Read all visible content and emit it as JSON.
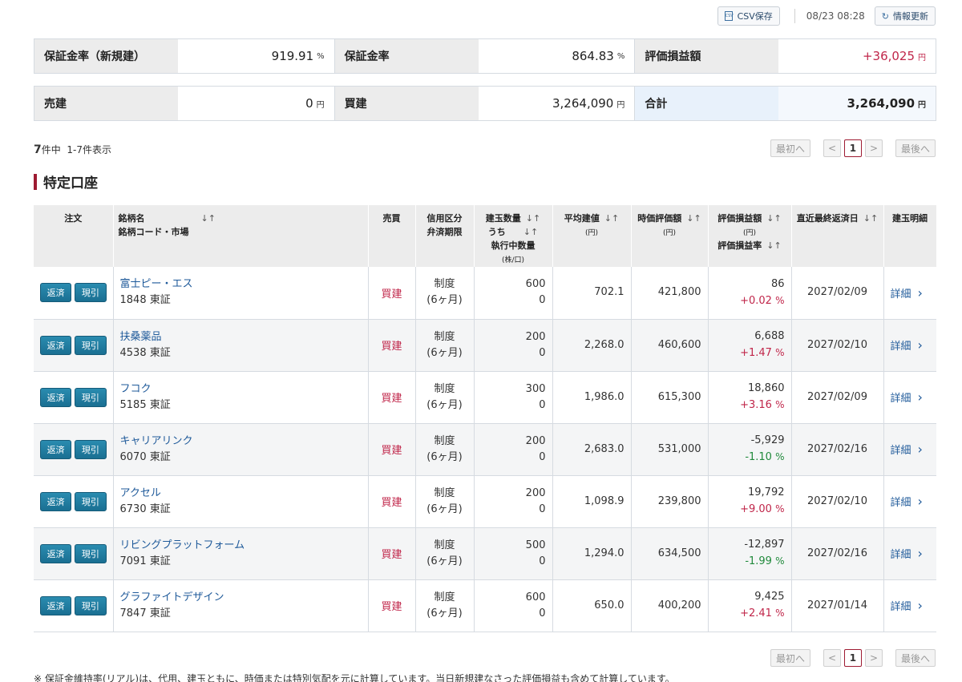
{
  "toolbar": {
    "csv_label": "CSV保存",
    "csv_icon_text": "CSV",
    "timestamp": "08/23 08:28",
    "refresh_label": "情報更新"
  },
  "summary": {
    "row1": [
      {
        "label": "保証金率（新規建）",
        "value": "919.91",
        "unit": "%"
      },
      {
        "label": "保証金率",
        "value": "864.83",
        "unit": "%"
      },
      {
        "label": "評価損益額",
        "value": "+36,025",
        "unit": "円"
      }
    ],
    "row2": [
      {
        "label": "売建",
        "value": "0",
        "unit": "円"
      },
      {
        "label": "買建",
        "value": "3,264,090",
        "unit": "円"
      },
      {
        "label": "合計",
        "value": "3,264,090",
        "unit": "円"
      }
    ]
  },
  "count": {
    "total": "7",
    "suffix": "件中",
    "range": "1-7件表示"
  },
  "pager": {
    "first": "最初へ",
    "prev": "<",
    "current": "1",
    "next": ">",
    "last": "最後へ"
  },
  "section_title": "特定口座",
  "table": {
    "headers": {
      "order": "注文",
      "name": "銘柄名",
      "name_sub": "銘柄コード・市場",
      "side": "売買",
      "credit": "信用区分",
      "credit_sub": "弁済期限",
      "qty": "建玉数量",
      "qty_sub1": "うち",
      "qty_sub2": "執行中数量",
      "qty_unit": "(株/口)",
      "avg": "平均建値",
      "avg_unit": "(円)",
      "mkt": "時価評価額",
      "mkt_unit": "(円)",
      "pl": "評価損益額",
      "pl_unit": "(円)",
      "pl_rate": "評価損益率",
      "due": "直近最終返済日",
      "detail": "建玉明細",
      "sort_icon": "↓↑"
    },
    "btn_close": "返済",
    "btn_delivery": "現引",
    "detail_label": "詳細",
    "rows": [
      {
        "name": "富士ピー・エス",
        "code": "1848 東証",
        "side": "買建",
        "credit": "制度",
        "term": "(6ヶ月)",
        "qty": "600",
        "exec": "0",
        "avg": "702.1",
        "mkt": "421,800",
        "pl": "86",
        "rate": "+0.02",
        "rate_unit": "%",
        "due": "2027/02/09"
      },
      {
        "name": "扶桑薬品",
        "code": "4538 東証",
        "side": "買建",
        "credit": "制度",
        "term": "(6ヶ月)",
        "qty": "200",
        "exec": "0",
        "avg": "2,268.0",
        "mkt": "460,600",
        "pl": "6,688",
        "rate": "+1.47",
        "rate_unit": "%",
        "due": "2027/02/10"
      },
      {
        "name": "フコク",
        "code": "5185 東証",
        "side": "買建",
        "credit": "制度",
        "term": "(6ヶ月)",
        "qty": "300",
        "exec": "0",
        "avg": "1,986.0",
        "mkt": "615,300",
        "pl": "18,860",
        "rate": "+3.16",
        "rate_unit": "%",
        "due": "2027/02/09"
      },
      {
        "name": "キャリアリンク",
        "code": "6070 東証",
        "side": "買建",
        "credit": "制度",
        "term": "(6ヶ月)",
        "qty": "200",
        "exec": "0",
        "avg": "2,683.0",
        "mkt": "531,000",
        "pl": "-5,929",
        "rate": "-1.10",
        "rate_unit": "%",
        "due": "2027/02/16"
      },
      {
        "name": "アクセル",
        "code": "6730 東証",
        "side": "買建",
        "credit": "制度",
        "term": "(6ヶ月)",
        "qty": "200",
        "exec": "0",
        "avg": "1,098.9",
        "mkt": "239,800",
        "pl": "19,792",
        "rate": "+9.00",
        "rate_unit": "%",
        "due": "2027/02/10"
      },
      {
        "name": "リビングプラットフォーム",
        "code": "7091 東証",
        "side": "買建",
        "credit": "制度",
        "term": "(6ヶ月)",
        "qty": "500",
        "exec": "0",
        "avg": "1,294.0",
        "mkt": "634,500",
        "pl": "-12,897",
        "rate": "-1.99",
        "rate_unit": "%",
        "due": "2027/02/16"
      },
      {
        "name": "グラファイトデザイン",
        "code": "7847 東証",
        "side": "買建",
        "credit": "制度",
        "term": "(6ヶ月)",
        "qty": "600",
        "exec": "0",
        "avg": "650.0",
        "mkt": "400,200",
        "pl": "9,425",
        "rate": "+2.41",
        "rate_unit": "%",
        "due": "2027/01/14"
      }
    ]
  },
  "footnote": "※ 保証金維持率(リアル)は、代用、建玉ともに、時価または特別気配を元に計算しています。当日新規建なさった評価損益も含めて計算しています。",
  "colors": {
    "accent": "#9e1b32",
    "positive": "#c0264a",
    "negative": "#218a3c",
    "link": "#1f5a9a",
    "order_button": "#1a6f92"
  }
}
